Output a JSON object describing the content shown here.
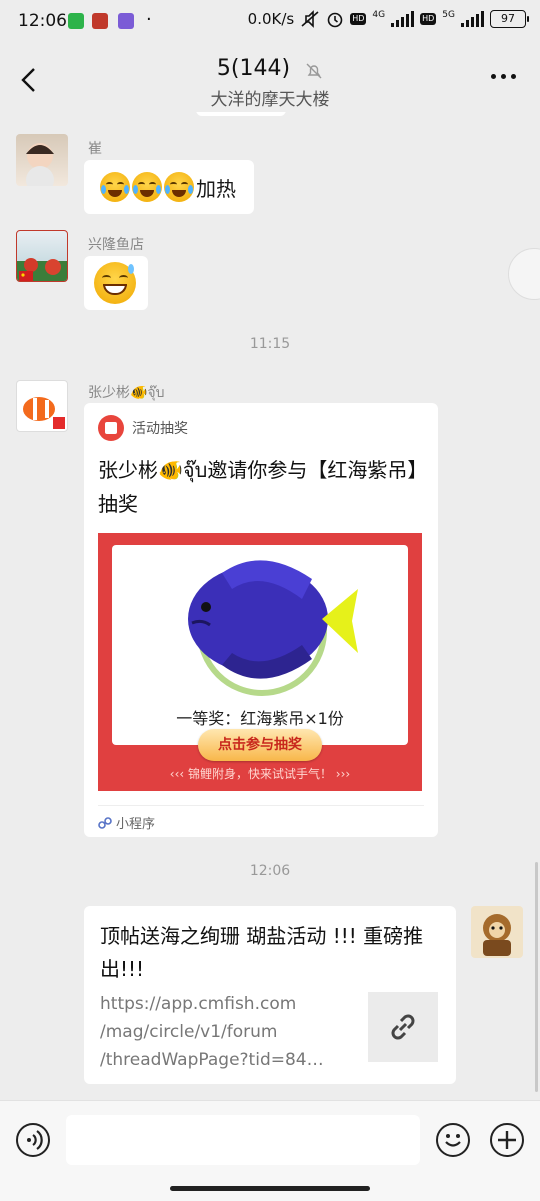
{
  "status_bar": {
    "time": "12:06",
    "network_speed": "0.0K/s",
    "hd1": "HD",
    "net1": "4G",
    "hd2": "HD",
    "net2": "5G",
    "battery": "97",
    "dot": "·"
  },
  "header": {
    "title": "5(144)",
    "subtitle": "大洋的摩天大楼"
  },
  "messages": [
    {
      "sender": "崔",
      "text": "加热"
    },
    {
      "sender": "兴隆鱼店"
    },
    {
      "timestamp": "11:15"
    },
    {
      "sender": "张少彬🐠จุ๊บ",
      "card": {
        "app_name": "活动抽奖",
        "title": "张少彬🐠จุ๊บ邀请你参与【红海紫吊】抽奖",
        "prize": "一等奖：红海紫吊×1份",
        "cta": "点击参与抽奖",
        "tagline": "‹‹‹   锦鲤附身，快来试试手气！   ›››",
        "source": "小程序"
      }
    },
    {
      "timestamp": "12:06"
    },
    {
      "link": {
        "title": "顶帖送海之绚珊 瑚盐活动 !!! 重磅推出!!!",
        "url": "https://app.cmfish.com\n/mag/circle/v1/forum\n/threadWapPage?tid=84…"
      }
    }
  ],
  "input": {
    "placeholder": ""
  },
  "colors": {
    "accent_red": "#e04040",
    "bg": "#ededed"
  }
}
